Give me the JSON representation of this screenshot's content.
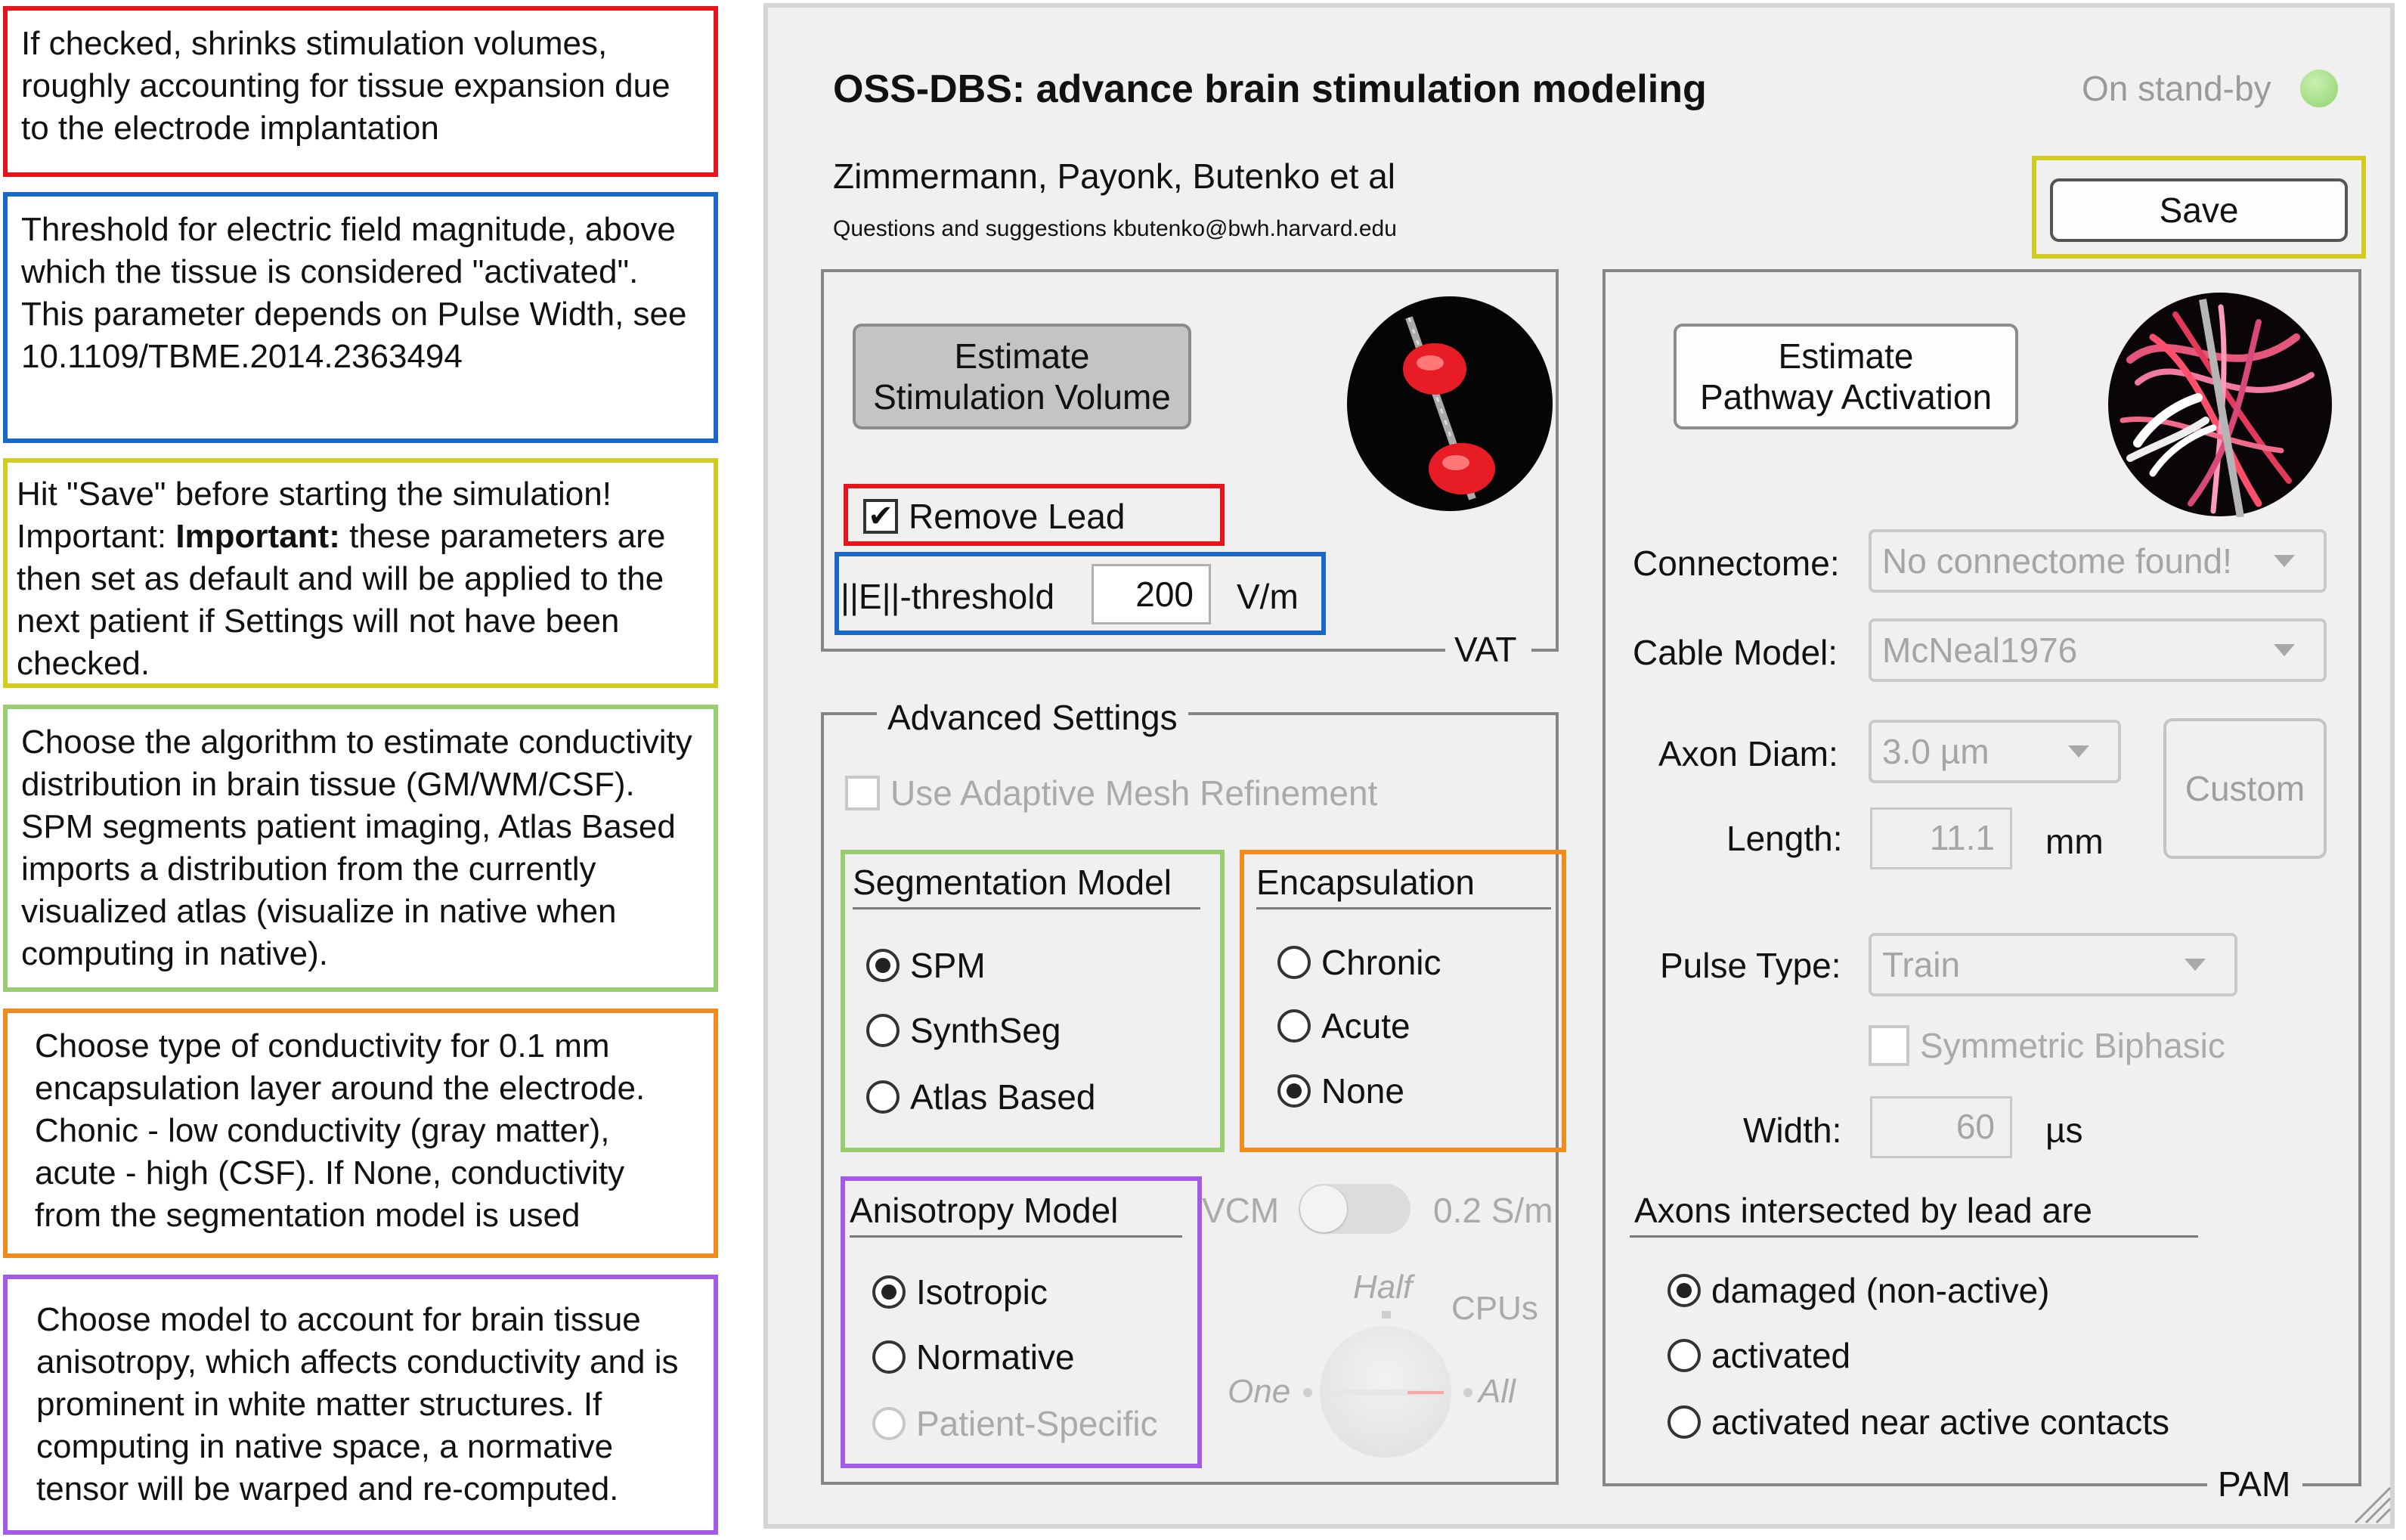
{
  "notes": {
    "remove_lead": "If checked, shrinks stimulation volumes, roughly accounting for tissue expansion due to the electrode implantation",
    "threshold": "Threshold for electric field magnitude, above which the tissue is considered \"activated\". This parameter depends on Pulse Width, see 10.1109/TBME.2014.2363494",
    "save_prefix": "Hit \"Save\" before starting the simulation! Important: ",
    "save_bold": "Important:",
    "save_suffix": " these parameters are then set as default and will be applied to the next patient if Settings will not have been checked.",
    "segmentation": "Choose the algorithm to estimate conductivity distribution in brain tissue (GM/WM/CSF). SPM segments patient imaging, Atlas Based imports a distribution from the currently visualized atlas (visualize in native when computing in native).",
    "encapsulation": "Choose type of conductivity for 0.1 mm encapsulation layer around the electrode. Chonic - low conductivity (gray matter), acute - high (CSF). If None, conductivity from the segmentation model is used",
    "anisotropy": "Choose model to account for brain tissue anisotropy, which affects conductivity and is prominent in white matter structures. If computing in native space, a normative tensor will be warped and re-computed."
  },
  "app": {
    "title": "OSS-DBS: advance brain stimulation modeling",
    "status": "On stand-by",
    "authors": "Zimmermann, Payonk, Butenko et al",
    "contact": "Questions and suggestions kbutenko@bwh.harvard.edu",
    "save": "Save"
  },
  "vat": {
    "estimate_line1": "Estimate",
    "estimate_line2": "Stimulation Volume",
    "remove_lead": "Remove Lead",
    "threshold_label": "||E||-threshold",
    "threshold_value": "200",
    "threshold_unit": "V/m",
    "group_label": "VAT"
  },
  "advanced": {
    "legend": "Advanced Settings",
    "adaptive_mesh": "Use Adaptive Mesh Refinement",
    "segmentation": {
      "title": "Segmentation Model",
      "options": [
        "SPM",
        "SynthSeg",
        "Atlas Based"
      ]
    },
    "encapsulation": {
      "title": "Encapsulation",
      "options": [
        "Chronic",
        "Acute",
        "None"
      ]
    },
    "anisotropy": {
      "title": "Anisotropy Model",
      "options": [
        "Isotropic",
        "Normative",
        "Patient-Specific"
      ]
    },
    "vcm_label": "VCM",
    "vcm_value": "0.2 S/m",
    "knob": {
      "half": "Half",
      "cpus": "CPUs",
      "one": "One",
      "all": "All"
    }
  },
  "pam": {
    "estimate_line1": "Estimate",
    "estimate_line2": "Pathway Activation",
    "connectome_label": "Connectome:",
    "connectome_value": "No connectome found!",
    "cable_label": "Cable Model:",
    "cable_value": "McNeal1976",
    "axon_label": "Axon Diam:",
    "axon_value": "3.0 µm",
    "custom": "Custom",
    "length_label": "Length:",
    "length_value": "11.1",
    "length_unit": "mm",
    "pulse_label": "Pulse Type:",
    "pulse_value": "Train",
    "symmetric": "Symmetric Biphasic",
    "width_label": "Width:",
    "width_value": "60",
    "width_unit": "µs",
    "axons_title": "Axons intersected by lead are",
    "axons_options": [
      "damaged (non-active)",
      "activated",
      "activated near active contacts"
    ],
    "group_label": "PAM"
  },
  "colors": {
    "red": "#e8141c",
    "blue": "#1b66c9",
    "yellow": "#d2cc21",
    "green": "#9acd70",
    "orange": "#f28a1c",
    "purple": "#a45ae8"
  }
}
